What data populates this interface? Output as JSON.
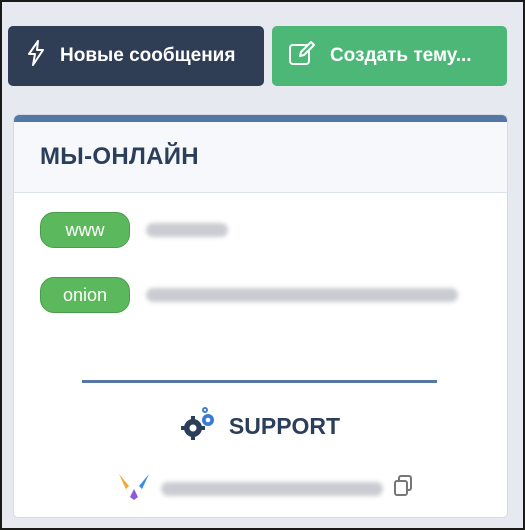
{
  "toolbar": {
    "new_messages_label": "Новые сообщения",
    "create_topic_label": "Создать тему..."
  },
  "block": {
    "title": "МЫ-ОНЛАЙН",
    "links": [
      {
        "tag": "www",
        "value_visible": false
      },
      {
        "tag": "onion",
        "value_visible": false
      }
    ],
    "support_label": "SUPPORT"
  },
  "colors": {
    "dark_button": "#2f3e55",
    "green_button": "#4cb777",
    "accent": "#5577a3",
    "badge_green": "#5cb85c",
    "heading_text": "#2b3e5a"
  },
  "icons": [
    "lightning-icon",
    "edit-icon",
    "gears-icon",
    "messenger-logo-icon",
    "copy-icon"
  ]
}
